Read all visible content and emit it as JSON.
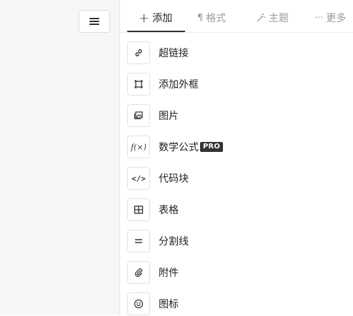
{
  "tabs": [
    {
      "label": "添加",
      "icon": "plus-icon",
      "active": true
    },
    {
      "label": "格式",
      "icon": "pilcrow-icon",
      "active": false
    },
    {
      "label": "主题",
      "icon": "magic-wand-icon",
      "active": false
    },
    {
      "label": "更多",
      "icon": "ellipsis-icon",
      "active": false
    }
  ],
  "items": [
    {
      "label": "超链接",
      "icon": "link-icon"
    },
    {
      "label": "添加外框",
      "icon": "frame-icon"
    },
    {
      "label": "图片",
      "icon": "image-icon"
    },
    {
      "label": "数学公式",
      "icon": "formula-icon",
      "badge": "PRO"
    },
    {
      "label": "代码块",
      "icon": "code-icon"
    },
    {
      "label": "表格",
      "icon": "table-icon"
    },
    {
      "label": "分割线",
      "icon": "divider-icon"
    },
    {
      "label": "附件",
      "icon": "paperclip-icon"
    },
    {
      "label": "图标",
      "icon": "smiley-icon"
    }
  ],
  "icon_glyphs": {
    "formula": "f(×)",
    "code": "</>"
  }
}
